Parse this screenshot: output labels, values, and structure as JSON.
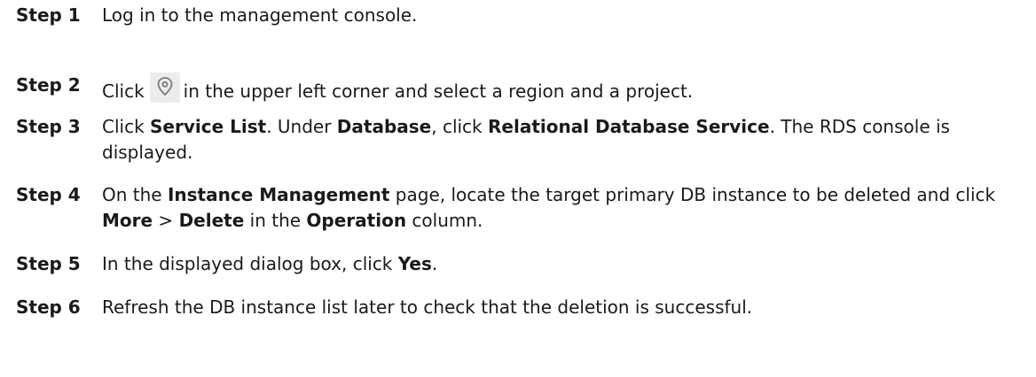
{
  "steps": [
    {
      "label": "Step 1",
      "parts": [
        "Log in to the management console."
      ]
    },
    {
      "label": "Step 2",
      "parts": [
        "Click",
        "in the upper left corner and select a region and a project."
      ],
      "icon": "location-pin-icon"
    },
    {
      "label": "Step 3",
      "parts": [
        "Click ",
        "Service List",
        ". Under ",
        "Database",
        ", click ",
        "Relational Database Service",
        ". The RDS console is displayed."
      ]
    },
    {
      "label": "Step 4",
      "parts": [
        "On the ",
        "Instance Management",
        " page, locate the target primary DB instance to be deleted and click ",
        "More",
        " > ",
        "Delete",
        " in the ",
        "Operation",
        " column."
      ]
    },
    {
      "label": "Step 5",
      "parts": [
        "In the displayed dialog box, click ",
        "Yes",
        "."
      ]
    },
    {
      "label": "Step 6",
      "parts": [
        "Refresh the DB instance list later to check that the deletion is successful."
      ]
    }
  ],
  "colors": {
    "text": "#1a1a1a",
    "icon_bg": "#ececec",
    "icon_stroke": "#7a7a7a"
  }
}
